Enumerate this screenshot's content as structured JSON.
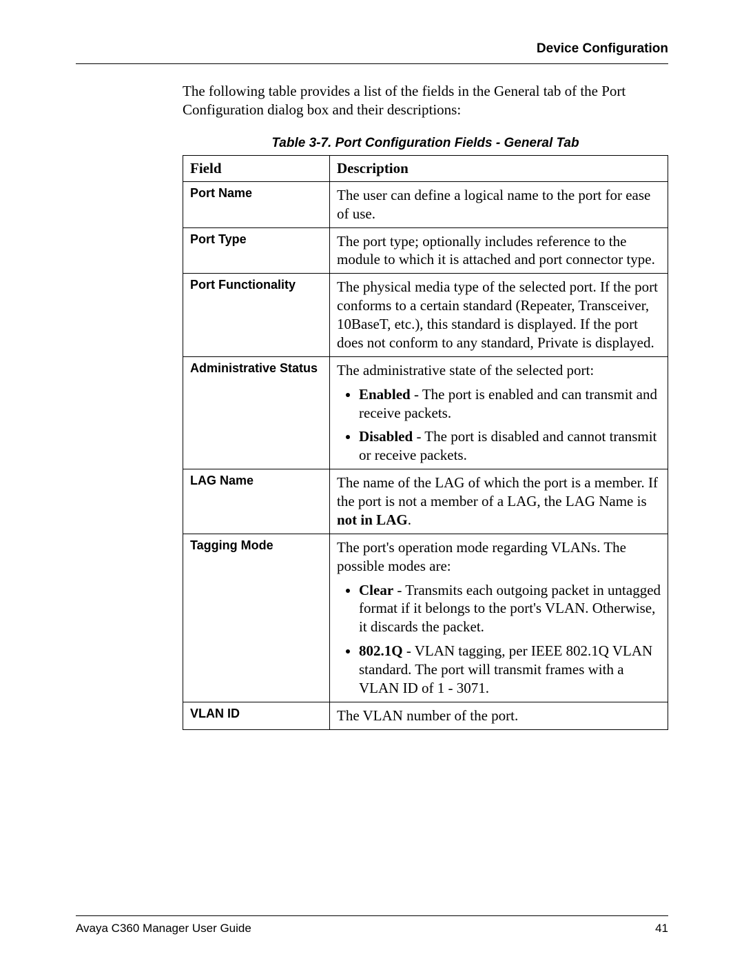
{
  "header": {
    "section": "Device Configuration"
  },
  "intro": "The following table provides a list of the fields in the General tab of the Port Configuration dialog box and their descriptions:",
  "table": {
    "caption": "Table 3-7.  Port Configuration Fields - General Tab",
    "head_field": "Field",
    "head_desc": "Description",
    "rows": {
      "port_name": {
        "field": "Port Name",
        "desc": "The user can define a logical name to the port for ease of use."
      },
      "port_type": {
        "field": "Port Type",
        "desc": "The port type; optionally includes reference to the module to which it is attached and port connector type."
      },
      "port_functionality": {
        "field": "Port Functionality",
        "desc": "The physical media type of the selected port. If the port conforms to a certain standard (Repeater, Transceiver, 10BaseT, etc.), this standard is displayed. If the port does not conform to any standard, Private is displayed."
      },
      "admin_status": {
        "field": "Administrative Status",
        "lead": "The administrative state of the selected port:",
        "bullets": {
          "enabled_bold": "Enabled",
          "enabled_rest": " - The port is enabled and can transmit and receive packets.",
          "disabled_bold": "Disabled",
          "disabled_rest": " - The port is disabled and cannot transmit or receive packets."
        }
      },
      "lag_name": {
        "field": "LAG Name",
        "pre": "The name of the LAG of which the port is a member. If the port is not a member of a LAG, the LAG Name is ",
        "bold": "not in LAG",
        "post": "."
      },
      "tagging_mode": {
        "field": "Tagging Mode",
        "lead": "The port's operation mode regarding VLANs. The possible modes are:",
        "bullets": {
          "clear_bold": "Clear",
          "clear_rest": " - Transmits each outgoing packet in untagged format if it belongs to the port's VLAN. Otherwise, it discards the packet.",
          "dot1q_bold": "802.1Q",
          "dot1q_rest": " - VLAN tagging, per IEEE 802.1Q VLAN standard. The port will transmit frames with a VLAN ID of 1 - 3071."
        }
      },
      "vlan_id": {
        "field": "VLAN ID",
        "desc": "The VLAN number of the port."
      }
    }
  },
  "footer": {
    "left": "Avaya C360 Manager User Guide",
    "right": "41"
  }
}
